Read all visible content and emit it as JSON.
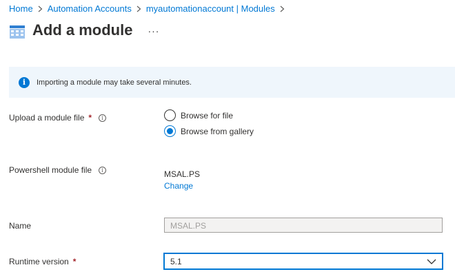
{
  "breadcrumb": {
    "items": [
      "Home",
      "Automation Accounts",
      "myautomationaccount | Modules"
    ]
  },
  "header": {
    "title": "Add a module",
    "more": "···"
  },
  "info": {
    "text": "Importing a module may take several minutes."
  },
  "form": {
    "upload": {
      "label": "Upload a module file",
      "required": "*",
      "options": [
        "Browse for file",
        "Browse from gallery"
      ],
      "selected": "Browse from gallery"
    },
    "ps_module": {
      "label": "Powershell module file",
      "value": "MSAL.PS",
      "change_link": "Change"
    },
    "name": {
      "label": "Name",
      "value": "MSAL.PS"
    },
    "runtime": {
      "label": "Runtime version",
      "required": "*",
      "value": "5.1"
    }
  },
  "colors": {
    "accent": "#0078d4",
    "info_bg": "#eff6fc",
    "required": "#a4262c"
  }
}
